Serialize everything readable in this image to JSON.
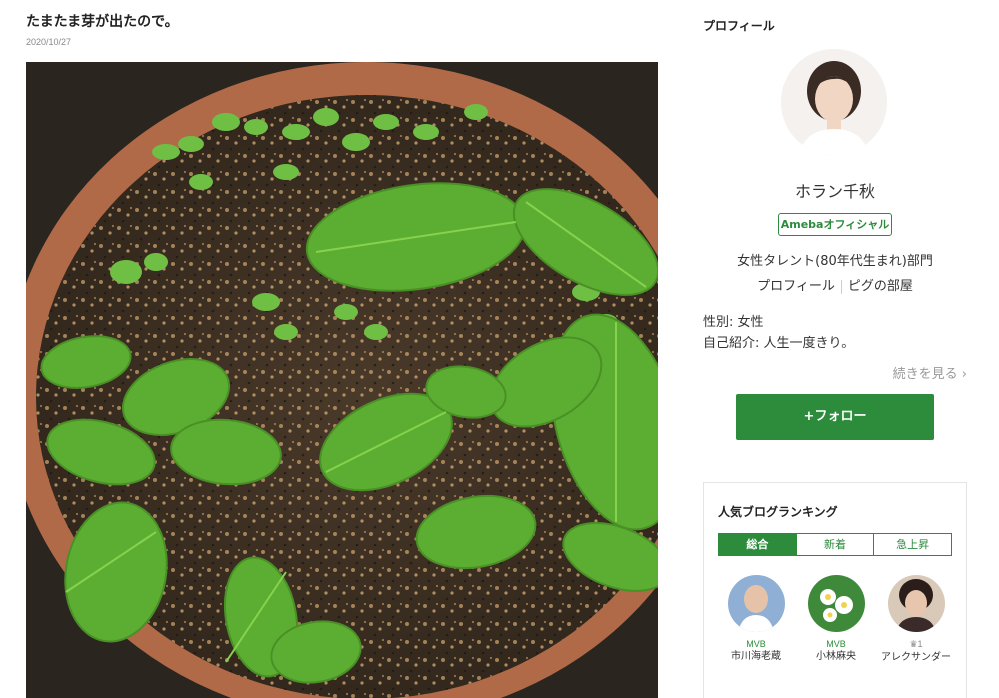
{
  "post": {
    "title": "たまたま芽が出たので。",
    "date": "2020/10/27"
  },
  "sidebar": {
    "heading": "プロフィール",
    "profile": {
      "name": "ホラン千秋",
      "badge": "Amebaオフィシャル",
      "category": "女性タレント(80年代生まれ)部門",
      "links": [
        "プロフィール",
        "ピグの部屋"
      ],
      "gender": "性別: 女性",
      "intro": "自己紹介: 人生一度きり。",
      "read_more": "続きを見る ›",
      "follow_label": "+フォロー"
    },
    "ranking": {
      "title": "人気ブログランキング",
      "tabs": [
        "総合",
        "新着",
        "急上昇"
      ],
      "items": [
        {
          "label": "MVB",
          "name": "市川海老蔵"
        },
        {
          "label": "MVB",
          "name": "小林麻央"
        },
        {
          "label": "♛1",
          "name": "アレクサンダー"
        }
      ]
    }
  },
  "colors": {
    "accent": "#2d8b3c"
  }
}
